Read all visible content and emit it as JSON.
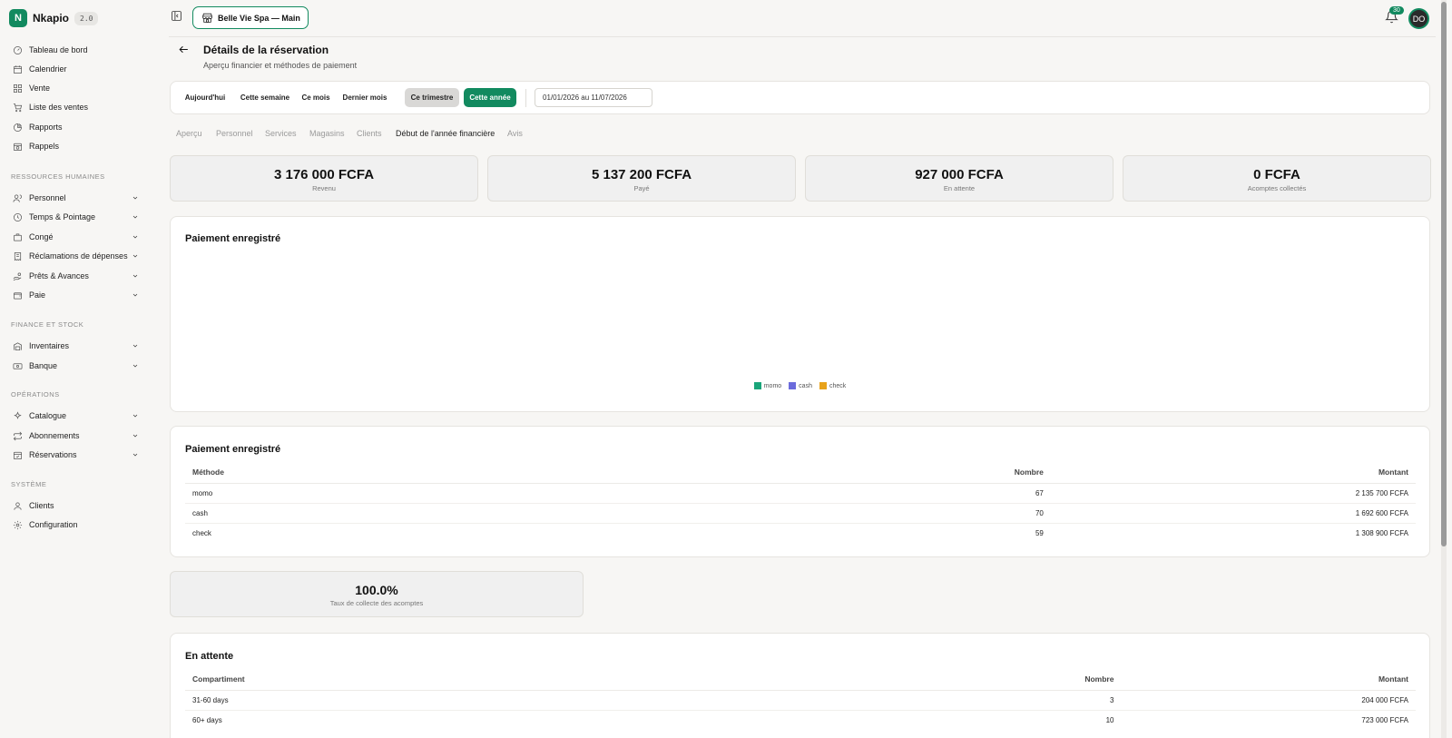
{
  "brand": {
    "name": "Nkapio",
    "version": "2.0"
  },
  "sidebar": {
    "main": [
      {
        "label": "Tableau de bord",
        "icon": "gauge-icon"
      },
      {
        "label": "Calendrier",
        "icon": "calendar-icon"
      },
      {
        "label": "Vente",
        "icon": "grid-icon"
      },
      {
        "label": "Liste des ventes",
        "icon": "cart-icon"
      },
      {
        "label": "Rapports",
        "icon": "pie-icon"
      },
      {
        "label": "Rappels",
        "icon": "calendar-clock-icon"
      }
    ],
    "hr_title": "RESSOURCES HUMAINES",
    "hr": [
      {
        "label": "Personnel",
        "icon": "users-icon"
      },
      {
        "label": "Temps & Pointage",
        "icon": "clock-icon"
      },
      {
        "label": "Congé",
        "icon": "briefcase-icon"
      },
      {
        "label": "Réclamations de dépenses",
        "icon": "receipt-icon"
      },
      {
        "label": "Prêts & Avances",
        "icon": "hand-coins-icon"
      },
      {
        "label": "Paie",
        "icon": "wallet-icon"
      }
    ],
    "finance_title": "FINANCE ET STOCK",
    "finance": [
      {
        "label": "Inventaires",
        "icon": "warehouse-icon"
      },
      {
        "label": "Banque",
        "icon": "banknote-icon"
      }
    ],
    "ops_title": "OPÉRATIONS",
    "ops": [
      {
        "label": "Catalogue",
        "icon": "sparkles-icon"
      },
      {
        "label": "Abonnements",
        "icon": "repeat-icon"
      },
      {
        "label": "Réservations",
        "icon": "calendar-check-icon"
      }
    ],
    "system_title": "SYSTÈME",
    "system": [
      {
        "label": "Clients",
        "icon": "user-icon"
      },
      {
        "label": "Configuration",
        "icon": "gear-icon"
      }
    ]
  },
  "topbar": {
    "store": "Belle Vie Spa — Main",
    "notifications": "30",
    "avatar": "DO"
  },
  "header": {
    "title": "Détails de la réservation",
    "subtitle": "Aperçu financier et méthodes de paiement"
  },
  "filters": {
    "buttons": [
      "Aujourd'hui",
      "Cette semaine",
      "Ce mois",
      "Dernier mois",
      "Ce trimestre",
      "Cette année"
    ],
    "selected": "Ce trimestre",
    "active": "Cette année",
    "date_range": "01/01/2026 au 11/07/2026"
  },
  "tabs": [
    "Aperçu",
    "Personnel",
    "Services",
    "Magasins",
    "Clients",
    "Début de l'année financière",
    "Avis"
  ],
  "active_tab": "Début de l'année financière",
  "stats": [
    {
      "value": "3 176 000 FCFA",
      "label": "Revenu"
    },
    {
      "value": "5 137 200 FCFA",
      "label": "Payé"
    },
    {
      "value": "927 000 FCFA",
      "label": "En attente"
    },
    {
      "value": "0 FCFA",
      "label": "Acomptes collectés"
    }
  ],
  "chart_card": {
    "title": "Paiement enregistré",
    "legend": [
      {
        "name": "momo",
        "color": "#1aa57a"
      },
      {
        "name": "cash",
        "color": "#6b6bdc"
      },
      {
        "name": "check",
        "color": "#e8a21a"
      }
    ]
  },
  "payments_table": {
    "title": "Paiement enregistré",
    "headers": [
      "Méthode",
      "Nombre",
      "Montant"
    ],
    "rows": [
      [
        "momo",
        "67",
        "2 135 700 FCFA"
      ],
      [
        "cash",
        "70",
        "1 692 600 FCFA"
      ],
      [
        "check",
        "59",
        "1 308 900 FCFA"
      ]
    ]
  },
  "collection_rate": {
    "value": "100.0%",
    "label": "Taux de collecte des acomptes"
  },
  "pending_table": {
    "title": "En attente",
    "headers": [
      "Compartiment",
      "Nombre",
      "Montant"
    ],
    "rows": [
      [
        "31-60 days",
        "3",
        "204 000 FCFA"
      ],
      [
        "60+ days",
        "10",
        "723 000 FCFA"
      ]
    ]
  },
  "colors": {
    "accent": "#128a5f"
  }
}
